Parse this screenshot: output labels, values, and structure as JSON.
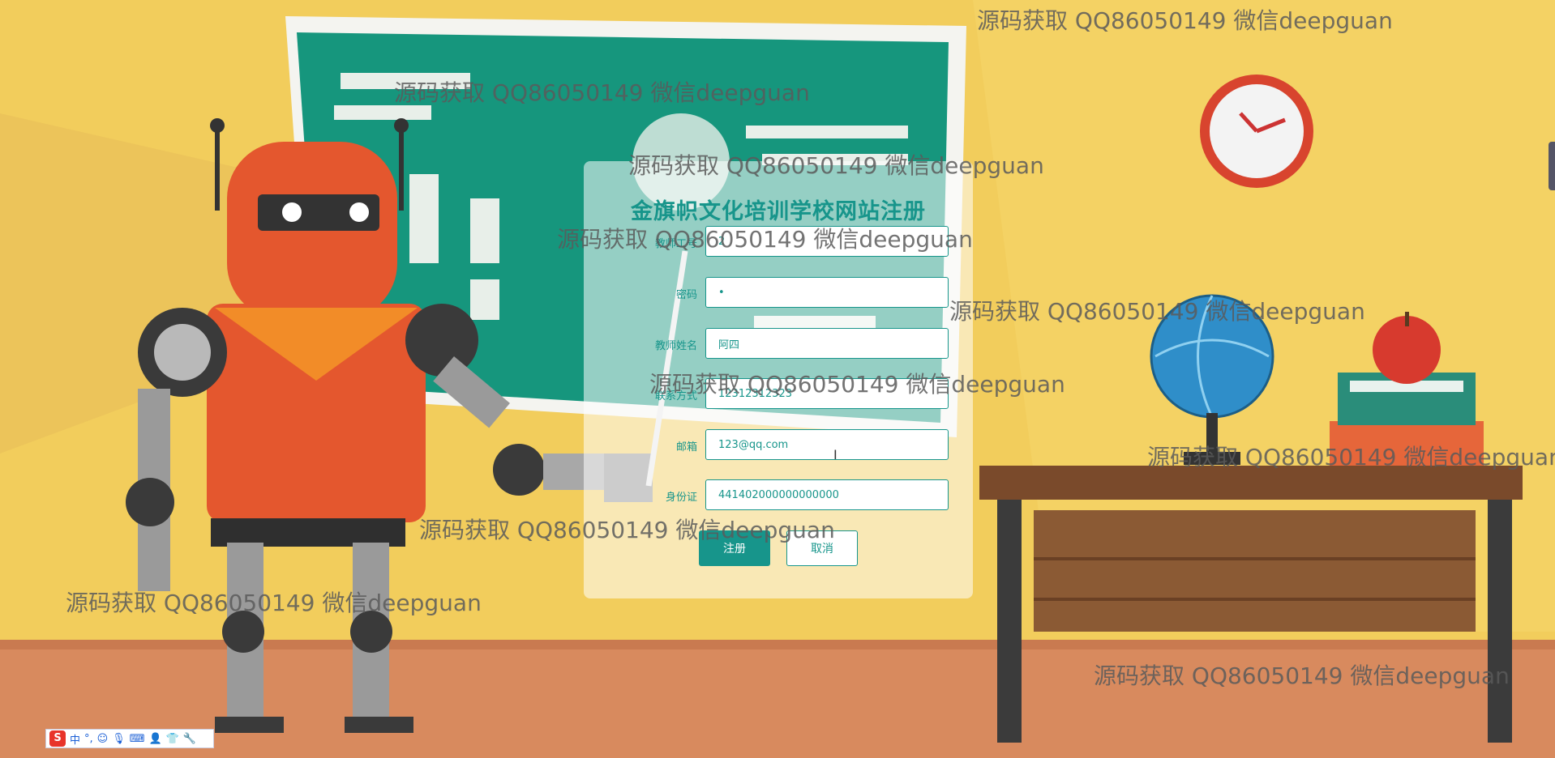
{
  "form": {
    "title": "金旗帜文化培训学校网站注册",
    "fields": [
      {
        "label": "教师工号",
        "value": "2"
      },
      {
        "label": "密码",
        "value": "•"
      },
      {
        "label": "教师姓名",
        "value": "阿四"
      },
      {
        "label": "联系方式",
        "value": "12312312323"
      },
      {
        "label": "邮箱",
        "value": "123@qq.com"
      },
      {
        "label": "身份证",
        "value": "441402000000000000"
      }
    ],
    "register_label": "注册",
    "cancel_label": "取消"
  },
  "watermark_text": "源码获取 QQ86050149 微信deepguan",
  "ime_toolbar": {
    "logo": "S",
    "mode": "中",
    "punct": "°,",
    "icons": [
      "emoji-icon",
      "microphone-icon",
      "keyboard-icon",
      "user-icon",
      "shirt-icon",
      "wrench-icon"
    ]
  },
  "colors": {
    "accent": "#17958b",
    "wall": "#f2cd5c",
    "board": "#16967d",
    "floor": "#d88a5e"
  }
}
